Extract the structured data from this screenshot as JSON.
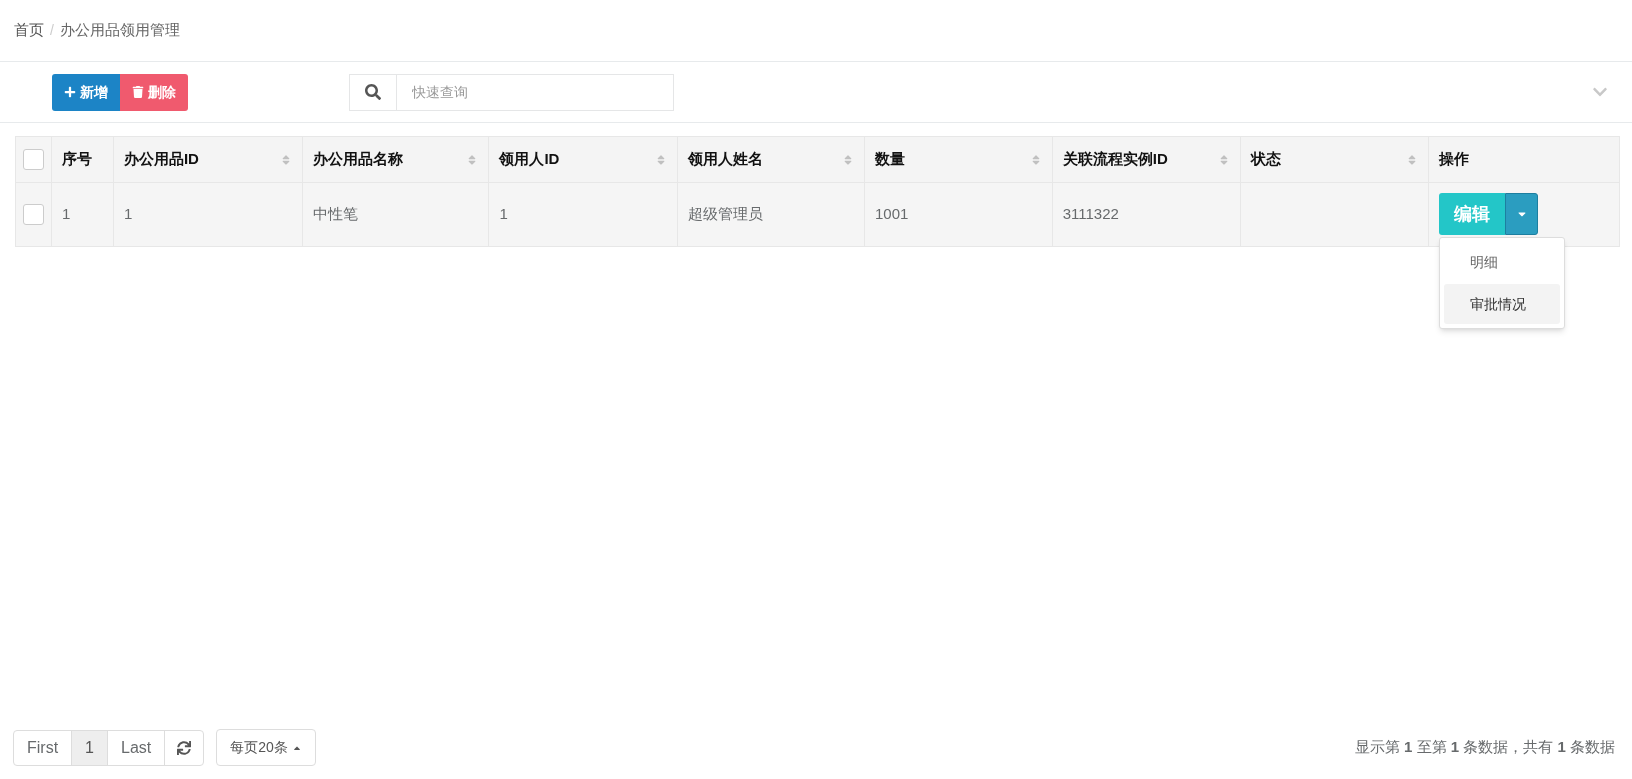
{
  "breadcrumb": [
    {
      "label": "首页"
    },
    {
      "label": "办公用品领用管理"
    }
  ],
  "breadcrumb_separator": "/",
  "toolbar": {
    "add_button": "新增",
    "delete_button": "删除",
    "search": {
      "placeholder": "快速查询"
    }
  },
  "table": {
    "select_all": {
      "checked": false
    },
    "columns": [
      {
        "label": "序号",
        "sortable": false
      },
      {
        "label": "办公用品ID",
        "sortable": true
      },
      {
        "label": "办公用品名称",
        "sortable": true
      },
      {
        "label": "领用人ID",
        "sortable": true
      },
      {
        "label": "领用人姓名",
        "sortable": true
      },
      {
        "label": "数量",
        "sortable": true
      },
      {
        "label": "关联流程实例ID",
        "sortable": true
      },
      {
        "label": "状态",
        "sortable": true
      },
      {
        "label": "操作",
        "sortable": false
      }
    ],
    "rows": [
      {
        "checked": false,
        "cells": [
          "1",
          "1",
          "中性笔",
          "1",
          "超级管理员",
          "1001",
          "3111322",
          ""
        ],
        "edit_button": "编辑",
        "menu": [
          {
            "label": "明细",
            "selected": false
          },
          {
            "label": "审批情况",
            "selected": true
          }
        ]
      }
    ]
  },
  "pagination": {
    "first": "First",
    "pages": [
      {
        "label": "1",
        "selected": true
      }
    ],
    "last": "Last",
    "page_size": "每页20条"
  },
  "summary": "显示第 **1** 至第 **1** 条数据，共有 **1** 条数据"
}
